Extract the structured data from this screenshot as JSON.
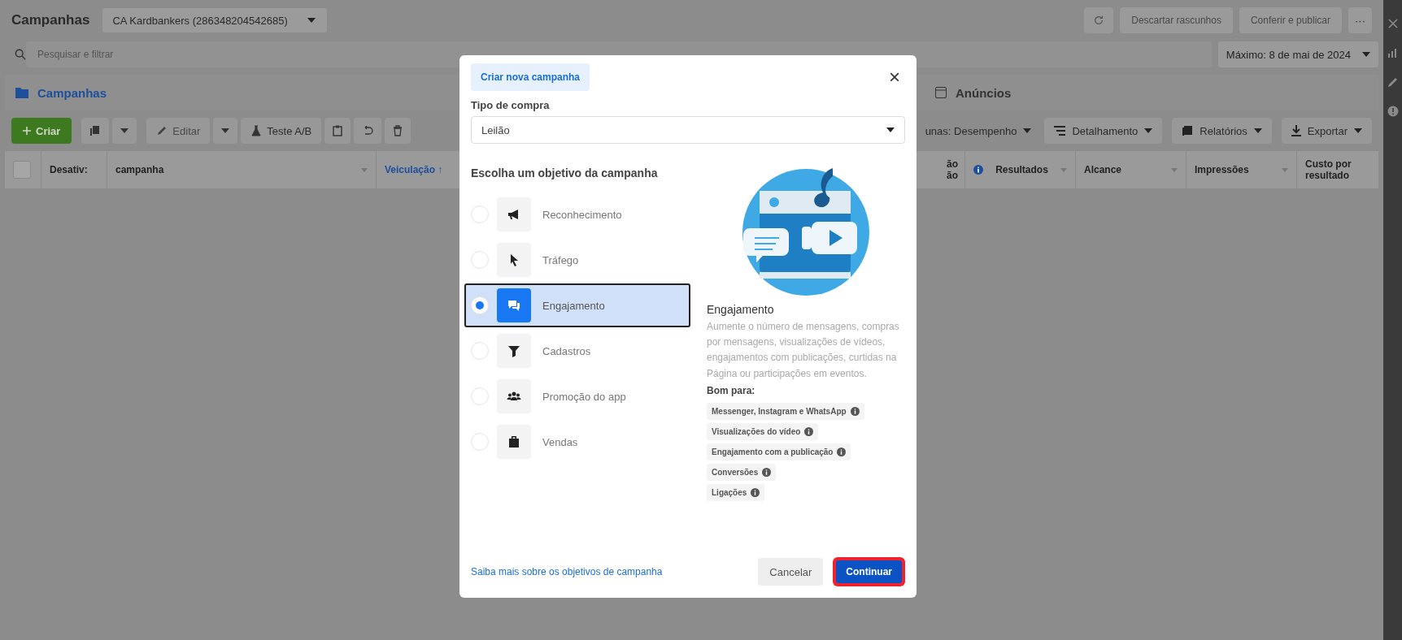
{
  "top_bar": {
    "title": "Campanhas",
    "account": "CA Kardbankers (286348204542685)",
    "buttons": [
      {
        "label": "Descartar rascunhos",
        "disabled": true
      },
      {
        "label": "Conferir e publicar",
        "disabled": true
      }
    ],
    "more": "···"
  },
  "search": {
    "placeholder": "Pesquisar e filtrar",
    "date_range": "Máximo: 8 de mai de 2024"
  },
  "tabs": [
    {
      "label": "Campanhas",
      "selected": true
    },
    {
      "label": "Anúncios",
      "selected": false
    }
  ],
  "toolbar": {
    "create": "Criar",
    "edit": {
      "label": "Editar",
      "disabled": true
    },
    "ab_test": "Teste A/B",
    "right": [
      "unas: Desempenho",
      "Detalhamento",
      "Relatórios",
      "Exportar"
    ]
  },
  "table": {
    "select_all_checked": false,
    "columns": [
      {
        "label": "Desativ:",
        "sortable": false
      },
      {
        "label": "campanha",
        "sortable": true
      },
      {
        "label": "Veiculação ↑",
        "sortable": false
      },
      {
        "label": "ão\não",
        "sortable": false
      },
      {
        "label": "Resultados",
        "sortable": true
      },
      {
        "label": "Alcance",
        "sortable": true
      },
      {
        "label": "Impressões",
        "sortable": true
      },
      {
        "label": "Custo por\nresultado",
        "sortable": false
      }
    ]
  },
  "dialog": {
    "tag": "Criar nova campanha",
    "close": "×",
    "purchase_label": "Tipo de compra",
    "purchase_value": "Leilão",
    "objective_heading": "Escolha um objetivo da campanha",
    "objectives": [
      {
        "label": "Reconhecimento",
        "selected": false
      },
      {
        "label": "Tráfego",
        "selected": false
      },
      {
        "label": "Engajamento",
        "selected": true
      },
      {
        "label": "Cadastros",
        "selected": false
      },
      {
        "label": "Promoção do app",
        "selected": false
      },
      {
        "label": "Vendas",
        "selected": false
      }
    ],
    "detail": {
      "title": "Engajamento",
      "description": "Aumente o número de mensagens, compras por mensagens, visualizações de vídeos, engajamentos com publicações, curtidas na Página ou participações em eventos.",
      "good_for_label": "Bom para:",
      "good_for": [
        "Messenger, Instagram e WhatsApp",
        "Visualizações do vídeo",
        "Engajamento com a publicação",
        "Conversões",
        "Ligações"
      ]
    },
    "learn_more": "Saiba mais sobre os objetivos de campanha",
    "cancel": "Cancelar",
    "continue": "Continuar",
    "continue_highlighted": true
  }
}
